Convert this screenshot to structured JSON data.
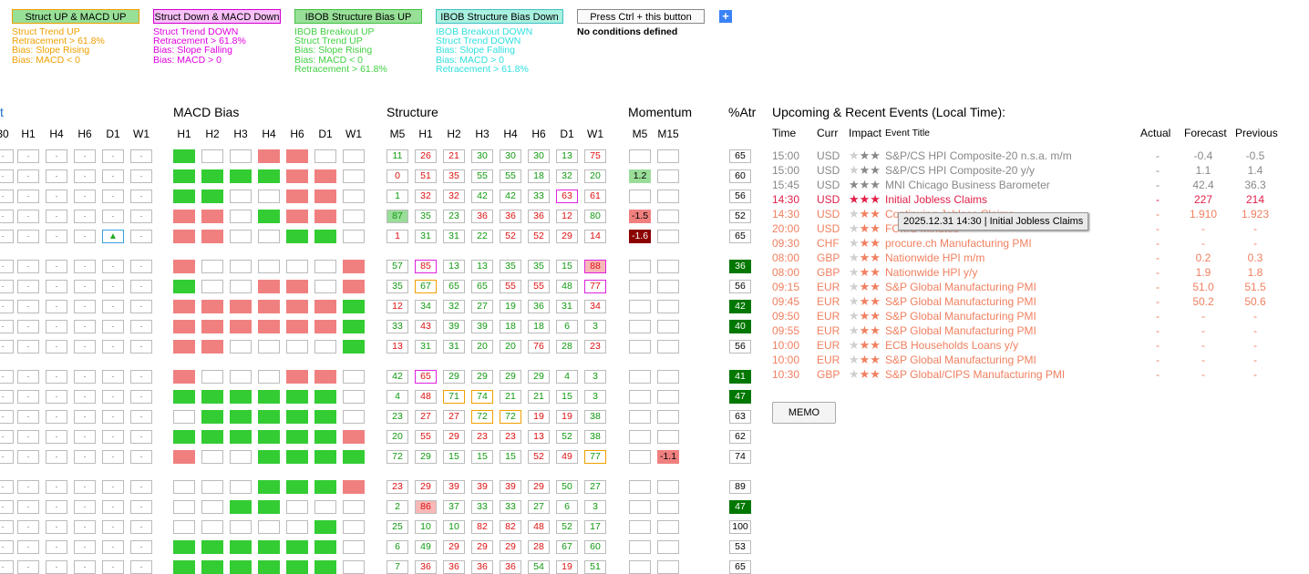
{
  "conditions": [
    {
      "label": "Struct UP & MACD UP",
      "bg": "#98e098",
      "border": "#e8a000",
      "text_color": "#f0a000",
      "lines": [
        "Struct Trend UP",
        "Retracement > 61.8%",
        "Bias: Slope Rising",
        "Bias: MACD < 0"
      ]
    },
    {
      "label": "Struct Down & MACD Down",
      "bg": "#f8c0f8",
      "border": "#d000d0",
      "text_color": "#e000e0",
      "lines": [
        "Struct Trend DOWN",
        "Retracement > 61.8%",
        "Bias: Slope Falling",
        "Bias: MACD > 0"
      ]
    },
    {
      "label": "IBOB Structure Bias UP",
      "bg": "#98e098",
      "border": "#40c040",
      "text_color": "#40d040",
      "lines": [
        "IBOB Breakout UP",
        "Struct Trend UP",
        "Bias: Slope Rising",
        "Bias: MACD < 0",
        "Retracement > 61.8%"
      ]
    },
    {
      "label": "IBOB Structure Bias Down",
      "bg": "#a8f0e0",
      "border": "#40c0c0",
      "text_color": "#30e0e0",
      "lines": [
        "IBOB Breakout DOWN",
        "Struct Trend DOWN",
        "Bias: Slope Falling",
        "Bias: MACD > 0",
        "Retracement > 61.8%"
      ]
    },
    {
      "label": "Press Ctrl + this button",
      "bg": "#fafafa",
      "border": "#888",
      "text_color": "#000",
      "lines": [
        "No conditions defined"
      ]
    }
  ],
  "add_button": "+",
  "left_partial": {
    "label": "t",
    "cols": [
      "30",
      "H1",
      "H4",
      "H6",
      "D1",
      "W1"
    ]
  },
  "macd": {
    "title": "MACD Bias",
    "cols": [
      "H1",
      "H2",
      "H3",
      "H4",
      "H6",
      "D1",
      "W1"
    ]
  },
  "structure": {
    "title": "Structure",
    "cols": [
      "M5",
      "H1",
      "H2",
      "H3",
      "H4",
      "H6",
      "D1",
      "W1"
    ]
  },
  "momentum": {
    "title": "Momentum",
    "cols": [
      "M5",
      "M15"
    ]
  },
  "atr": {
    "title": "%Atr"
  },
  "colors": {
    "green": "#33cc33",
    "red": "#f08080",
    "dark_green": "#007700",
    "dark_red": "#8b0000"
  },
  "rows": [
    {
      "g": 0,
      "macd": "GEERREE",
      "s": [
        [
          "11",
          "g"
        ],
        [
          "26",
          "r"
        ],
        [
          "21",
          "r"
        ],
        [
          "30",
          "g"
        ],
        [
          "30",
          "g"
        ],
        [
          "30",
          "g"
        ],
        [
          "13",
          "g"
        ],
        [
          "75",
          "r"
        ]
      ],
      "mom": [
        "",
        ""
      ],
      "atr": "65",
      "atrs": "n",
      "tri": false
    },
    {
      "g": 0,
      "macd": "GGGGRRE",
      "s": [
        [
          "0",
          "r"
        ],
        [
          "51",
          "r"
        ],
        [
          "35",
          "r"
        ],
        [
          "55",
          "g"
        ],
        [
          "55",
          "g"
        ],
        [
          "18",
          "g"
        ],
        [
          "32",
          "g"
        ],
        [
          "20",
          "g"
        ]
      ],
      "mom": [
        "1.2",
        ""
      ],
      "atr": "60",
      "atrs": "n",
      "tri": false
    },
    {
      "g": 0,
      "macd": "GGEERRE",
      "s": [
        [
          "1",
          "g"
        ],
        [
          "32",
          "r"
        ],
        [
          "32",
          "r"
        ],
        [
          "42",
          "g"
        ],
        [
          "42",
          "g"
        ],
        [
          "33",
          "g"
        ],
        [
          "63",
          "rm"
        ],
        [
          "61",
          "r"
        ]
      ],
      "mom": [
        "",
        ""
      ],
      "atr": "56",
      "atrs": "n",
      "tri": false
    },
    {
      "g": 0,
      "macd": "RREGRRE",
      "s": [
        [
          "87",
          "gf"
        ],
        [
          "35",
          "g"
        ],
        [
          "23",
          "g"
        ],
        [
          "36",
          "r"
        ],
        [
          "36",
          "r"
        ],
        [
          "36",
          "r"
        ],
        [
          "12",
          "r"
        ],
        [
          "80",
          "g"
        ]
      ],
      "mom": [
        "-1.5",
        ""
      ],
      "atr": "52",
      "atrs": "n",
      "tri": false
    },
    {
      "g": 0,
      "macd": "RREEGGE",
      "s": [
        [
          "1",
          "r"
        ],
        [
          "31",
          "g"
        ],
        [
          "31",
          "g"
        ],
        [
          "22",
          "g"
        ],
        [
          "52",
          "r"
        ],
        [
          "52",
          "r"
        ],
        [
          "29",
          "r"
        ],
        [
          "14",
          "r"
        ]
      ],
      "mom": [
        "-1.6",
        ""
      ],
      "atr": "65",
      "atrs": "n",
      "tri": true
    },
    {
      "g": 1,
      "macd": "REEEEER",
      "s": [
        [
          "57",
          "g"
        ],
        [
          "85",
          "rm"
        ],
        [
          "13",
          "g"
        ],
        [
          "13",
          "g"
        ],
        [
          "35",
          "g"
        ],
        [
          "35",
          "g"
        ],
        [
          "15",
          "g"
        ],
        [
          "88",
          "rmf"
        ]
      ],
      "mom": [
        "",
        ""
      ],
      "atr": "36",
      "atrs": "dg",
      "tri": false
    },
    {
      "g": 1,
      "macd": "GEERRER",
      "s": [
        [
          "35",
          "g"
        ],
        [
          "67",
          "go"
        ],
        [
          "65",
          "g"
        ],
        [
          "65",
          "g"
        ],
        [
          "55",
          "r"
        ],
        [
          "55",
          "r"
        ],
        [
          "48",
          "g"
        ],
        [
          "77",
          "rm"
        ]
      ],
      "mom": [
        "",
        ""
      ],
      "atr": "56",
      "atrs": "n",
      "tri": false
    },
    {
      "g": 1,
      "macd": "RRRRRRG",
      "s": [
        [
          "12",
          "r"
        ],
        [
          "34",
          "g"
        ],
        [
          "32",
          "g"
        ],
        [
          "27",
          "g"
        ],
        [
          "19",
          "g"
        ],
        [
          "36",
          "g"
        ],
        [
          "31",
          "g"
        ],
        [
          "34",
          "r"
        ]
      ],
      "mom": [
        "",
        ""
      ],
      "atr": "42",
      "atrs": "dg",
      "tri": false
    },
    {
      "g": 1,
      "macd": "RRRRRRG",
      "s": [
        [
          "33",
          "g"
        ],
        [
          "43",
          "r"
        ],
        [
          "39",
          "g"
        ],
        [
          "39",
          "g"
        ],
        [
          "18",
          "g"
        ],
        [
          "18",
          "g"
        ],
        [
          "6",
          "g"
        ],
        [
          "3",
          "g"
        ]
      ],
      "mom": [
        "",
        ""
      ],
      "atr": "40",
      "atrs": "dg",
      "tri": false
    },
    {
      "g": 1,
      "macd": "RREEEEG",
      "s": [
        [
          "13",
          "r"
        ],
        [
          "31",
          "g"
        ],
        [
          "31",
          "g"
        ],
        [
          "20",
          "g"
        ],
        [
          "20",
          "g"
        ],
        [
          "76",
          "r"
        ],
        [
          "28",
          "g"
        ],
        [
          "23",
          "r"
        ]
      ],
      "mom": [
        "",
        ""
      ],
      "atr": "56",
      "atrs": "n",
      "tri": false
    },
    {
      "g": 2,
      "macd": "REEERRE",
      "s": [
        [
          "42",
          "g"
        ],
        [
          "65",
          "rm"
        ],
        [
          "29",
          "g"
        ],
        [
          "29",
          "g"
        ],
        [
          "29",
          "g"
        ],
        [
          "29",
          "g"
        ],
        [
          "4",
          "g"
        ],
        [
          "3",
          "g"
        ]
      ],
      "mom": [
        "",
        ""
      ],
      "atr": "41",
      "atrs": "dg",
      "tri": false
    },
    {
      "g": 2,
      "macd": "GGGGGGE",
      "s": [
        [
          "4",
          "g"
        ],
        [
          "48",
          "r"
        ],
        [
          "71",
          "go"
        ],
        [
          "74",
          "go"
        ],
        [
          "21",
          "g"
        ],
        [
          "21",
          "g"
        ],
        [
          "15",
          "g"
        ],
        [
          "3",
          "g"
        ]
      ],
      "mom": [
        "",
        ""
      ],
      "atr": "47",
      "atrs": "dg",
      "tri": false
    },
    {
      "g": 2,
      "macd": "EGGGGGE",
      "s": [
        [
          "23",
          "g"
        ],
        [
          "27",
          "r"
        ],
        [
          "27",
          "r"
        ],
        [
          "72",
          "go"
        ],
        [
          "72",
          "go"
        ],
        [
          "19",
          "r"
        ],
        [
          "19",
          "r"
        ],
        [
          "38",
          "g"
        ]
      ],
      "mom": [
        "",
        ""
      ],
      "atr": "63",
      "atrs": "n",
      "tri": false
    },
    {
      "g": 2,
      "macd": "GGGGGGR",
      "s": [
        [
          "20",
          "g"
        ],
        [
          "55",
          "r"
        ],
        [
          "29",
          "r"
        ],
        [
          "23",
          "r"
        ],
        [
          "23",
          "r"
        ],
        [
          "13",
          "r"
        ],
        [
          "52",
          "g"
        ],
        [
          "38",
          "g"
        ]
      ],
      "mom": [
        "",
        ""
      ],
      "atr": "62",
      "atrs": "n",
      "tri": false
    },
    {
      "g": 2,
      "macd": "REEGGGG",
      "s": [
        [
          "72",
          "g"
        ],
        [
          "29",
          "g"
        ],
        [
          "15",
          "g"
        ],
        [
          "15",
          "g"
        ],
        [
          "15",
          "g"
        ],
        [
          "52",
          "r"
        ],
        [
          "49",
          "r"
        ],
        [
          "77",
          "go"
        ]
      ],
      "mom": [
        "",
        "-1.1"
      ],
      "atr": "74",
      "atrs": "n",
      "tri": false
    },
    {
      "g": 3,
      "macd": "EEEGGGR",
      "s": [
        [
          "23",
          "r"
        ],
        [
          "29",
          "r"
        ],
        [
          "39",
          "r"
        ],
        [
          "39",
          "r"
        ],
        [
          "39",
          "r"
        ],
        [
          "29",
          "r"
        ],
        [
          "50",
          "g"
        ],
        [
          "27",
          "g"
        ]
      ],
      "mom": [
        "",
        ""
      ],
      "atr": "89",
      "atrs": "n",
      "tri": false
    },
    {
      "g": 3,
      "macd": "EEGGEEE",
      "s": [
        [
          "2",
          "g"
        ],
        [
          "86",
          "rf"
        ],
        [
          "37",
          "g"
        ],
        [
          "33",
          "g"
        ],
        [
          "33",
          "g"
        ],
        [
          "27",
          "g"
        ],
        [
          "6",
          "g"
        ],
        [
          "3",
          "g"
        ]
      ],
      "mom": [
        "",
        ""
      ],
      "atr": "47",
      "atrs": "dg",
      "tri": false
    },
    {
      "g": 3,
      "macd": "EEEEEGE",
      "s": [
        [
          "25",
          "g"
        ],
        [
          "10",
          "g"
        ],
        [
          "10",
          "g"
        ],
        [
          "82",
          "r"
        ],
        [
          "82",
          "r"
        ],
        [
          "48",
          "r"
        ],
        [
          "52",
          "g"
        ],
        [
          "17",
          "g"
        ]
      ],
      "mom": [
        "",
        ""
      ],
      "atr": "100",
      "atrs": "n",
      "tri": false
    },
    {
      "g": 3,
      "macd": "GGGGGGE",
      "s": [
        [
          "6",
          "g"
        ],
        [
          "49",
          "g"
        ],
        [
          "29",
          "r"
        ],
        [
          "29",
          "r"
        ],
        [
          "29",
          "r"
        ],
        [
          "28",
          "r"
        ],
        [
          "67",
          "g"
        ],
        [
          "60",
          "g"
        ]
      ],
      "mom": [
        "",
        ""
      ],
      "atr": "53",
      "atrs": "n",
      "tri": false
    },
    {
      "g": 3,
      "macd": "GGGGGGE",
      "s": [
        [
          "7",
          "g"
        ],
        [
          "36",
          "r"
        ],
        [
          "36",
          "r"
        ],
        [
          "36",
          "r"
        ],
        [
          "36",
          "r"
        ],
        [
          "54",
          "g"
        ],
        [
          "19",
          "r"
        ],
        [
          "51",
          "g"
        ]
      ],
      "mom": [
        "",
        ""
      ],
      "atr": "65",
      "atrs": "n",
      "tri": false
    }
  ],
  "events": {
    "title": "Upcoming & Recent Events (Local Time):",
    "headers": {
      "time": "Time",
      "curr": "Curr",
      "impact": "Impact",
      "title": "Event Title",
      "actual": "Actual",
      "forecast": "Forecast",
      "previous": "Previous"
    },
    "items": [
      {
        "time": "15:00",
        "curr": "USD",
        "stars": "★★",
        "title": "S&P/CS HPI Composite-20 n.s.a. m/m",
        "actual": "-",
        "forecast": "-0.4",
        "previous": "-0.5",
        "color": "#888888",
        "star_color": "#888888"
      },
      {
        "time": "15:00",
        "curr": "USD",
        "stars": "★★",
        "title": "S&P/CS HPI Composite-20 y/y",
        "actual": "-",
        "forecast": "1.1",
        "previous": "1.4",
        "color": "#888888",
        "star_color": "#888888"
      },
      {
        "time": "15:45",
        "curr": "USD",
        "stars": "★★★",
        "title": "MNI Chicago Business Barometer",
        "actual": "-",
        "forecast": "42.4",
        "previous": "36.3",
        "color": "#888888",
        "star_color": "#888888"
      },
      {
        "time": "14:30",
        "curr": "USD",
        "stars": "★★★",
        "title": "Initial Jobless Claims",
        "actual": "-",
        "forecast": "227",
        "previous": "214",
        "color": "#e0204a",
        "star_color": "#e0204a"
      },
      {
        "time": "14:30",
        "curr": "USD",
        "stars": "★★",
        "title": "Continuing Jobless Claims",
        "actual": "-",
        "forecast": "1.910",
        "previous": "1.923",
        "color": "#f08060",
        "star_color": "#f08060"
      },
      {
        "time": "20:00",
        "curr": "USD",
        "stars": "★★",
        "title": "FOMC Minutes",
        "actual": "-",
        "forecast": "-",
        "previous": "-",
        "color": "#f08060",
        "star_color": "#f08060"
      },
      {
        "time": "09:30",
        "curr": "CHF",
        "stars": "★★",
        "title": "procure.ch Manufacturing PMI",
        "actual": "-",
        "forecast": "-",
        "previous": "-",
        "color": "#f08060",
        "star_color": "#f08060"
      },
      {
        "time": "08:00",
        "curr": "GBP",
        "stars": "★★",
        "title": "Nationwide HPI m/m",
        "actual": "-",
        "forecast": "0.2",
        "previous": "0.3",
        "color": "#f08060",
        "star_color": "#f08060"
      },
      {
        "time": "08:00",
        "curr": "GBP",
        "stars": "★★",
        "title": "Nationwide HPI y/y",
        "actual": "-",
        "forecast": "1.9",
        "previous": "1.8",
        "color": "#f08060",
        "star_color": "#f08060"
      },
      {
        "time": "09:15",
        "curr": "EUR",
        "stars": "★★",
        "title": "S&P Global Manufacturing PMI",
        "actual": "-",
        "forecast": "51.0",
        "previous": "51.5",
        "color": "#f08060",
        "star_color": "#f08060"
      },
      {
        "time": "09:45",
        "curr": "EUR",
        "stars": "★★",
        "title": "S&P Global Manufacturing PMI",
        "actual": "-",
        "forecast": "50.2",
        "previous": "50.6",
        "color": "#f08060",
        "star_color": "#f08060"
      },
      {
        "time": "09:50",
        "curr": "EUR",
        "stars": "★★",
        "title": "S&P Global Manufacturing PMI",
        "actual": "-",
        "forecast": "-",
        "previous": "-",
        "color": "#f08060",
        "star_color": "#f08060"
      },
      {
        "time": "09:55",
        "curr": "EUR",
        "stars": "★★",
        "title": "S&P Global Manufacturing PMI",
        "actual": "-",
        "forecast": "-",
        "previous": "-",
        "color": "#f08060",
        "star_color": "#f08060"
      },
      {
        "time": "10:00",
        "curr": "EUR",
        "stars": "★★",
        "title": "ECB Households Loans y/y",
        "actual": "-",
        "forecast": "-",
        "previous": "-",
        "color": "#f08060",
        "star_color": "#f08060"
      },
      {
        "time": "10:00",
        "curr": "EUR",
        "stars": "★★",
        "title": "S&P Global Manufacturing PMI",
        "actual": "-",
        "forecast": "-",
        "previous": "-",
        "color": "#f08060",
        "star_color": "#f08060"
      },
      {
        "time": "10:30",
        "curr": "GBP",
        "stars": "★★",
        "title": "S&P Global/CIPS Manufacturing PMI",
        "actual": "-",
        "forecast": "-",
        "previous": "-",
        "color": "#f08060",
        "star_color": "#f08060"
      }
    ],
    "tooltip": "2025.12.31 14:30 | Initial Jobless Claims",
    "memo_label": "MEMO"
  }
}
